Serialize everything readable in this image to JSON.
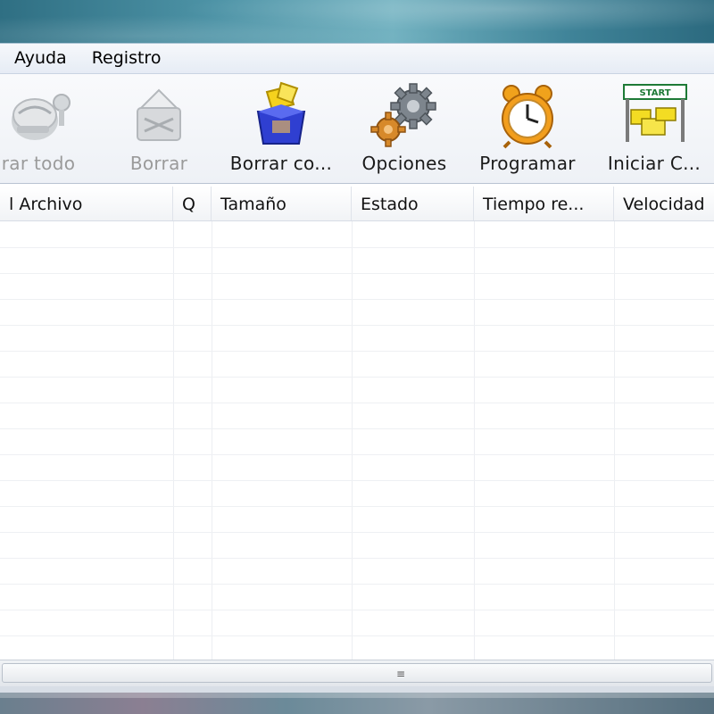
{
  "menu": {
    "items": [
      "Ayuda",
      "Registro"
    ]
  },
  "toolbar": {
    "buttons": [
      {
        "label": "rar todo",
        "icon": "delete-all-icon",
        "enabled": false
      },
      {
        "label": "Borrar",
        "icon": "delete-icon",
        "enabled": false
      },
      {
        "label": "Borrar co...",
        "icon": "delete-completed-icon",
        "enabled": true
      },
      {
        "label": "Opciones",
        "icon": "gears-icon",
        "enabled": true
      },
      {
        "label": "Programar",
        "icon": "alarm-clock-icon",
        "enabled": true
      },
      {
        "label": "Iniciar C...",
        "icon": "start-queue-icon",
        "enabled": true
      }
    ]
  },
  "table": {
    "columns": [
      "l Archivo",
      "Q",
      "Tamaño",
      "Estado",
      "Tiempo re...",
      "Velocidad"
    ],
    "rows": []
  },
  "scrollbar": {
    "grip": "≡"
  }
}
